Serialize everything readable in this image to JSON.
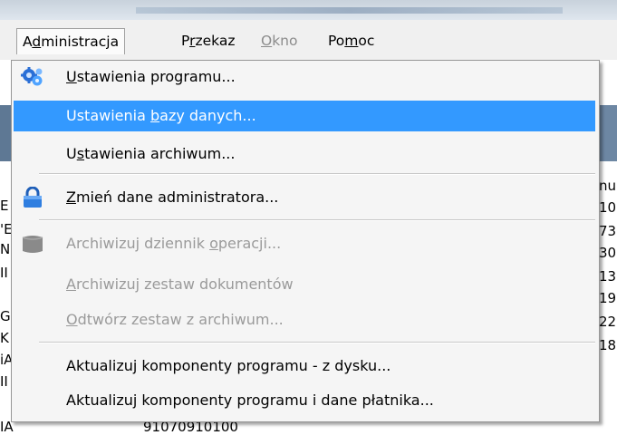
{
  "menubar": {
    "items": [
      {
        "pre": "A",
        "u": "d",
        "post": "ministracja",
        "state": "open"
      },
      {
        "pre": "P",
        "u": "r",
        "post": "zekaz",
        "state": "normal"
      },
      {
        "pre": "",
        "u": "O",
        "post": "kno",
        "state": "disabled"
      },
      {
        "pre": "Po",
        "u": "m",
        "post": "oc",
        "state": "normal"
      }
    ]
  },
  "menu": {
    "items": [
      {
        "pre": "",
        "u": "U",
        "post": "stawienia programu...",
        "icon": "settings-gears-icon",
        "state": "normal"
      },
      {
        "pre": "Ustawienia ",
        "u": "b",
        "post": "azy danych...",
        "icon": "",
        "state": "selected"
      },
      {
        "pre": "U",
        "u": "s",
        "post": "tawienia archiwum...",
        "icon": "",
        "state": "normal"
      },
      {
        "pre": "",
        "u": "Z",
        "post": "mień dane administratora...",
        "icon": "padlock-icon",
        "state": "normal"
      },
      {
        "pre": "Archiwizuj dziennik ",
        "u": "o",
        "post": "peracji...",
        "icon": "archive-icon",
        "state": "disabled"
      },
      {
        "pre": "",
        "u": "A",
        "post": "rchiwizuj zestaw dokumentów",
        "icon": "",
        "state": "disabled"
      },
      {
        "pre": "",
        "u": "O",
        "post": "dtwórz zestaw z archiwum...",
        "icon": "",
        "state": "disabled"
      },
      {
        "pre": "Aktualizuj komponenty programu - z dysku...",
        "u": "",
        "post": "",
        "icon": "",
        "state": "normal"
      },
      {
        "pre": "Aktualizuj komponenty programu i dane płatnika...",
        "u": "",
        "post": "",
        "icon": "",
        "state": "normal"
      }
    ]
  },
  "background": {
    "left_letters": [
      "E",
      "'E",
      "N",
      "II",
      "G",
      "K",
      "iA",
      "II",
      "IA"
    ],
    "right_values": [
      "nu",
      "10",
      "73",
      "30",
      "13",
      "19",
      "22",
      "18"
    ],
    "bottom_value": "91070910100"
  },
  "colors": {
    "selection": "#3399ff",
    "disabled_text": "#9a9a9a",
    "menubar": "#f0f0f0"
  }
}
